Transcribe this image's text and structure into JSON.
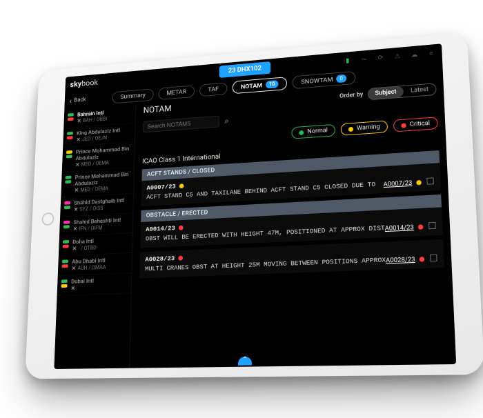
{
  "app": {
    "logo1": "sky",
    "logo2": "book",
    "flight": "23 DHX102"
  },
  "back_label": "Back",
  "tabs": {
    "summary": "Summary",
    "metar": "METAR",
    "taf": "TAF",
    "notam": "NOTAM",
    "notam_count": "10",
    "snowtam": "SNOWTAM",
    "snowtam_count": "0"
  },
  "page_title": "NOTAM",
  "search": {
    "placeholder": "Search NOTAMS"
  },
  "orderby": {
    "label": "Order by",
    "subject": "Subject",
    "latest": "Latest"
  },
  "filters": {
    "normal": "Normal",
    "warning": "Warning",
    "critical": "Critical"
  },
  "section_title": "ICAO Class 1 International",
  "groups": [
    {
      "header": "ACFT STANDS / CLOSED",
      "items": [
        {
          "id": "A0007/23",
          "sev": "y",
          "body": "ACFT STAND C5 AND TAXILANE BEHIND ACFT STAND C5 CLOSED DUE TO",
          "link": "A0007/23"
        }
      ]
    },
    {
      "header": "OBSTACLE / ERECTED",
      "items": [
        {
          "id": "A0014/23",
          "sev": "r",
          "body": "OBST WILL BE ERECTED WITH HEIGHT 47M, POSITIONED AT APPROX DIST",
          "link": "A0014/23"
        },
        {
          "id": "A0028/23",
          "sev": "r",
          "body": "MULTI CRANES OBST AT HEIGHT 25M MOVING BETWEEN POSITIONS APPROX",
          "link": "A0028/23"
        }
      ]
    }
  ],
  "airports": [
    {
      "name": "Bahrain Intl",
      "code": "BAH / OBBI",
      "active": true,
      "d1": "grn",
      "d2": "red"
    },
    {
      "name": "King Abdulaziz Intl",
      "code": "JED / OEJN",
      "active": false,
      "d1": "grn",
      "d2": "red"
    },
    {
      "name": "Prince Mohammad Bin Abdulaziz",
      "code": "MED / OEMA",
      "active": false,
      "d1": "yel",
      "d2": "grn"
    },
    {
      "name": "Prince Mohammad Bin Abdulaziz",
      "code": "MED / OEMA",
      "active": false,
      "d1": "grn",
      "d2": "grn"
    },
    {
      "name": "Shahid Dastghaib Intl",
      "code": "SYZ / OISS",
      "active": false,
      "d1": "mag",
      "d2": "grn"
    },
    {
      "name": "Shahid Beheshti Intl",
      "code": "IFN / OIFM",
      "active": false,
      "d1": "mag",
      "d2": "grn"
    },
    {
      "name": "Doha Intl",
      "code": "- / OTBD",
      "active": false,
      "d1": "grn",
      "d2": "red"
    },
    {
      "name": "Abu Dhabi Intl",
      "code": "AUH / OMAA",
      "active": false,
      "d1": "grn",
      "d2": "red"
    },
    {
      "name": "Dubai Intl",
      "code": "",
      "active": false,
      "d1": "grn",
      "d2": "yel"
    }
  ]
}
